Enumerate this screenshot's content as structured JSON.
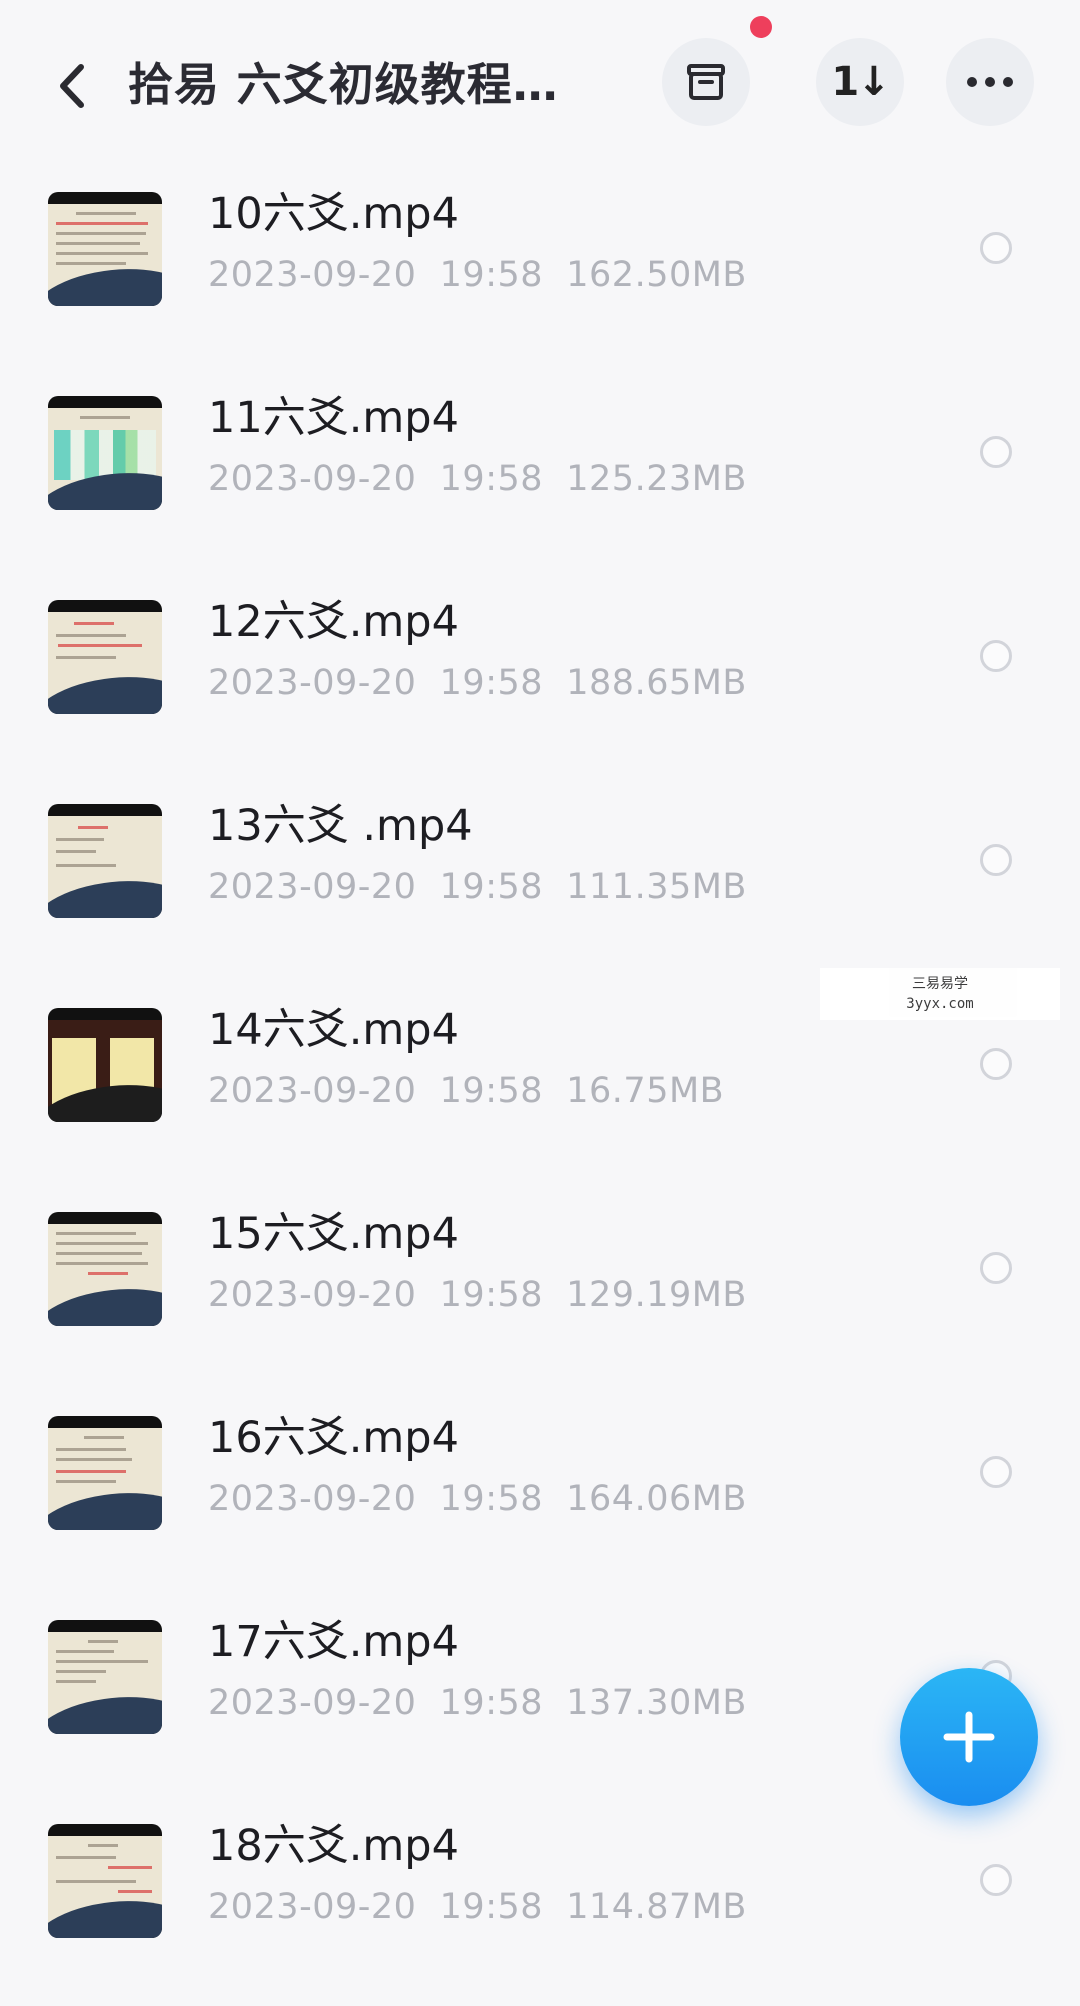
{
  "header": {
    "title": "拾易 六爻初级教程…",
    "icons": {
      "back": "chevron-left-icon",
      "archive": "archive-box-icon",
      "sort": "sort-icon",
      "more": "more-horizontal-icon",
      "add": "plus-icon"
    },
    "sort_glyph": "1↓",
    "notification_color": "#ee3f5c"
  },
  "files": [
    {
      "name": "10六爻.mp4",
      "meta": "2023-09-20  19:58  162.50MB"
    },
    {
      "name": "11六爻.mp4",
      "meta": "2023-09-20  19:58  125.23MB"
    },
    {
      "name": "12六爻.mp4",
      "meta": "2023-09-20  19:58  188.65MB"
    },
    {
      "name": "13六爻 .mp4",
      "meta": "2023-09-20  19:58  111.35MB"
    },
    {
      "name": "14六爻.mp4",
      "meta": "2023-09-20  19:58  16.75MB"
    },
    {
      "name": "15六爻.mp4",
      "meta": "2023-09-20  19:58  129.19MB"
    },
    {
      "name": "16六爻.mp4",
      "meta": "2023-09-20  19:58  164.06MB"
    },
    {
      "name": "17六爻.mp4",
      "meta": "2023-09-20  19:58  137.30MB"
    },
    {
      "name": "18六爻.mp4",
      "meta": "2023-09-20  19:58  114.87MB"
    }
  ],
  "watermark": {
    "line1": "三易易学",
    "line2": "3yyx.com"
  },
  "colors": {
    "accent": "#1a8df0",
    "meta_text": "#b1b3ba",
    "background": "#f7f7f9"
  }
}
